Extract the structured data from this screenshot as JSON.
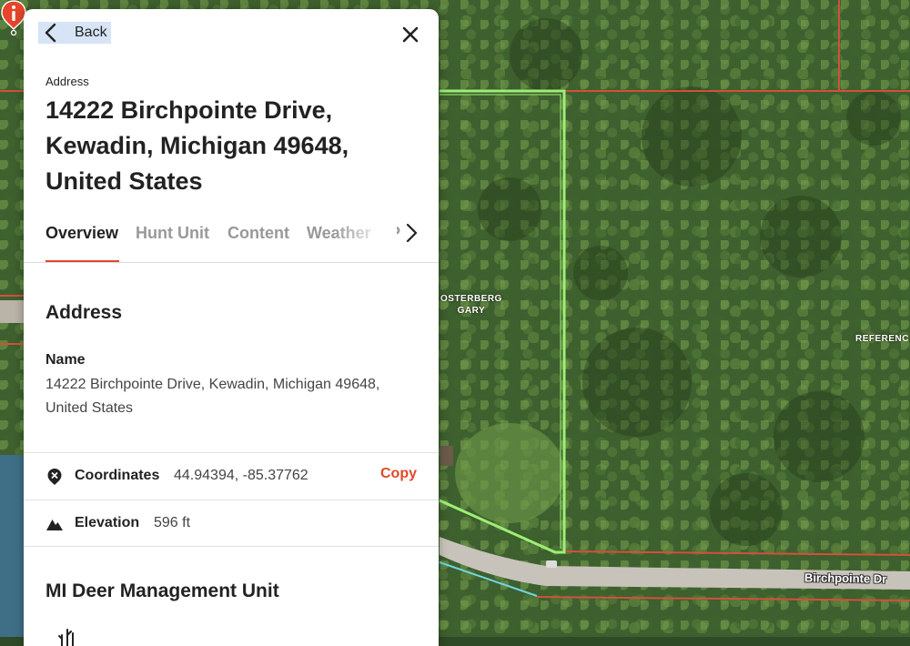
{
  "map": {
    "owner_label_line1": "OSTERBERG",
    "owner_label_line2": "GARY",
    "edge_label": "REFERENC",
    "road_label": "Birchpointe Dr",
    "colors": {
      "parcel_line": "#d2513a",
      "selected_parcel": "#9cf075",
      "road": "#c8c3ba",
      "pin": "#e5452a"
    }
  },
  "panel": {
    "back_label": "Back",
    "address_caption": "Address",
    "address_title": "14222 Birchpointe Drive, Kewadin, Michigan 49648, United States",
    "tabs": [
      "Overview",
      "Hunt Unit",
      "Content",
      "Weather",
      "P"
    ],
    "active_tab": "Overview",
    "address_section_title": "Address",
    "name_label": "Name",
    "name_value": "14222 Birchpointe Drive, Kewadin, Michigan 49648, United States",
    "coordinates_label": "Coordinates",
    "coordinates_value": "44.94394, -85.37762",
    "copy_label": "Copy",
    "elevation_label": "Elevation",
    "elevation_value": "596 ft",
    "unit_section_title": "MI Deer Management Unit",
    "accent_color": "#e04a2a"
  }
}
